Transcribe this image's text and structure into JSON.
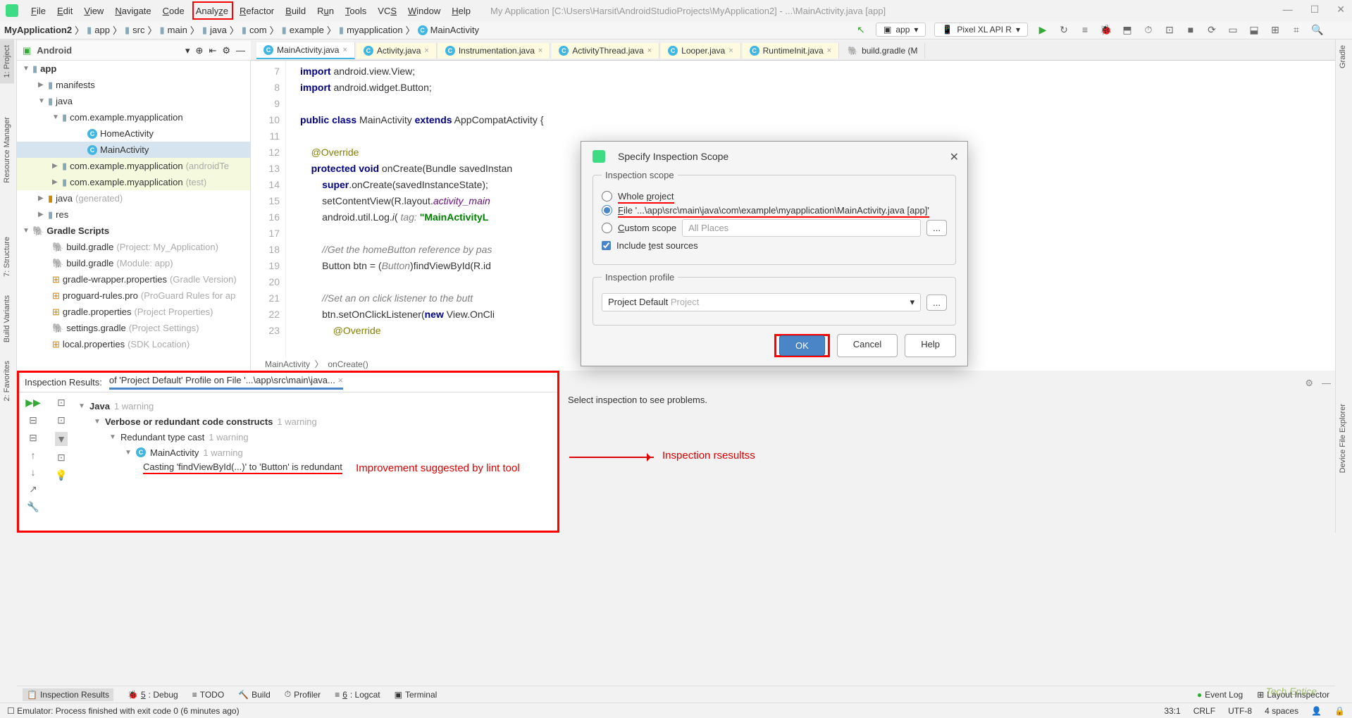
{
  "menu": [
    "File",
    "Edit",
    "View",
    "Navigate",
    "Code",
    "Analyze",
    "Refactor",
    "Build",
    "Run",
    "Tools",
    "VCS",
    "Window",
    "Help"
  ],
  "title": "My Application [C:\\Users\\Harsit\\AndroidStudioProjects\\MyApplication2] - ...\\MainActivity.java [app]",
  "breadcrumb": [
    "MyApplication2",
    "app",
    "src",
    "main",
    "java",
    "com",
    "example",
    "myapplication",
    "MainActivity"
  ],
  "run_config": "app",
  "device": "Pixel XL API R",
  "proj_view": "Android",
  "tree": {
    "app": "app",
    "manifests": "manifests",
    "java": "java",
    "pkg1": "com.example.myapplication",
    "home": "HomeActivity",
    "main": "MainActivity",
    "pkg2": "com.example.myapplication",
    "pkg2_hint": "(androidTe",
    "pkg3": "com.example.myapplication",
    "pkg3_hint": "(test)",
    "javagen": "java",
    "javagen_hint": "(generated)",
    "res": "res",
    "gradle_scripts": "Gradle Scripts",
    "bg1": "build.gradle",
    "bg1_h": "(Project: My_Application)",
    "bg2": "build.gradle",
    "bg2_h": "(Module: app)",
    "gwp": "gradle-wrapper.properties",
    "gwp_h": "(Gradle Version)",
    "pg": "proguard-rules.pro",
    "pg_h": "(ProGuard Rules for ap",
    "gp": "gradle.properties",
    "gp_h": "(Project Properties)",
    "sg": "settings.gradle",
    "sg_h": "(Project Settings)",
    "lp": "local.properties",
    "lp_h": "(SDK Location)"
  },
  "tabs": [
    "MainActivity.java",
    "Activity.java",
    "Instrumentation.java",
    "ActivityThread.java",
    "Looper.java",
    "RuntimeInit.java",
    "build.gradle (M"
  ],
  "code_lines": [
    7,
    8,
    9,
    10,
    11,
    12,
    13,
    14,
    15,
    16,
    17,
    18,
    19,
    20,
    21,
    22,
    23
  ],
  "code": {
    "l7": "import android.view.View;",
    "l8": "import android.widget.Button;",
    "l10": "public class MainActivity extends AppCompatActivity {",
    "l12": "@Override",
    "l13": "protected void onCreate(Bundle savedInstan",
    "l14": "super.onCreate(savedInstanceState);",
    "l15a": "setContentView(R.layout.",
    "l15b": "activity_main",
    "l16a": "android.util.Log.i( ",
    "l16b": "tag: ",
    "l16c": "\"MainActivityL",
    "l18": "//Get the homeButton reference by pas",
    "l19a": "Button btn = (",
    "l19b": "Button",
    "l19c": ")findViewById(R.id",
    "l21": "//Set an on click listener to the butt",
    "l22": "btn.setOnClickListener(new View.OnCli",
    "l23": "@Override"
  },
  "crumbs_bottom": [
    "MainActivity",
    "onCreate()"
  ],
  "dialog": {
    "title": "Specify Inspection Scope",
    "scope_legend": "Inspection scope",
    "whole": "Whole project",
    "file": "File '...\\app\\src\\main\\java\\com\\example\\myapplication\\MainActivity.java [app]'",
    "custom": "Custom scope",
    "all_places": "All Places",
    "include": "Include test sources",
    "profile_legend": "Inspection profile",
    "profile_val": "Project Default",
    "profile_hint": "Project",
    "ok": "OK",
    "cancel": "Cancel",
    "help": "Help"
  },
  "inspection": {
    "label": "Inspection Results:",
    "tab": "of 'Project Default' Profile on File '...\\app\\src\\main\\java...",
    "java": "Java",
    "java_w": "1 warning",
    "verbose": "Verbose or redundant code constructs",
    "verbose_w": "1 warning",
    "redundant": "Redundant type cast",
    "redundant_w": "1 warning",
    "mainact": "MainActivity",
    "mainact_w": "1 warning",
    "cast": "Casting 'findViewById(...)' to 'Button' is redundant",
    "right_msg": "Select inspection to see problems.",
    "anno1": "Improvement suggested by lint tool",
    "anno2": "Inspection rsesultss"
  },
  "bottom_tools": [
    "Inspection Results",
    "5: Debug",
    "TODO",
    "Build",
    "Profiler",
    "6: Logcat",
    "Terminal"
  ],
  "bottom_right": [
    "Event Log",
    "Layout Inspector"
  ],
  "status": {
    "msg": "Emulator: Process finished with exit code 0 (6 minutes ago)",
    "pos": "33:1",
    "eol": "CRLF",
    "enc": "UTF-8",
    "indent": "4 spaces"
  },
  "rails": {
    "project": "1: Project",
    "resmgr": "Resource Manager",
    "struct": "7: Structure",
    "build": "Build Variants",
    "fav": "2: Favorites",
    "gradle": "Gradle",
    "devfs": "Device File Explorer"
  },
  "watermark": "Tech Entice"
}
